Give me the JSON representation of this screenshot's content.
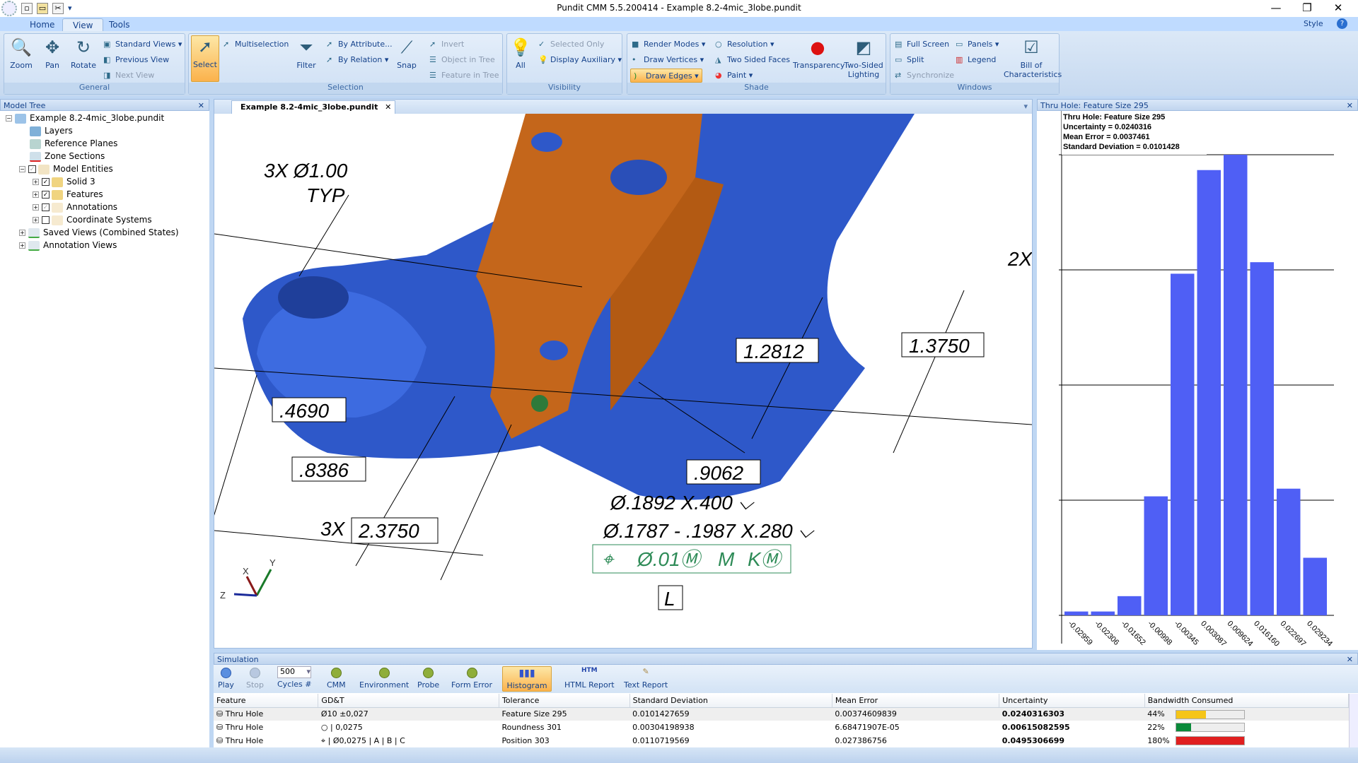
{
  "window": {
    "title": "Pundit CMM 5.5.200414 - Example 8.2-4mic_3lobe.pundit",
    "minimize": "—",
    "restore": "❐",
    "close": "✕"
  },
  "ribbon_tabs": [
    "Home",
    "View",
    "Tools"
  ],
  "active_tab": "View",
  "style_menu": "Style",
  "groups": {
    "general": {
      "label": "General",
      "zoom": "Zoom",
      "pan": "Pan",
      "rotate": "Rotate",
      "standard_views": "Standard Views",
      "previous_view": "Previous View",
      "next_view": "Next View"
    },
    "selection": {
      "label": "Selection",
      "select": "Select",
      "multiselection": "Multiselection",
      "filter": "Filter",
      "by_attribute": "By Attribute...",
      "by_relation": "By Relation",
      "snap": "Snap",
      "invert": "Invert",
      "object_in_tree": "Object in Tree",
      "feature_in_tree": "Feature in Tree"
    },
    "visibility": {
      "label": "Visibility",
      "all": "All",
      "selected_only": "Selected Only",
      "display_auxiliary": "Display Auxiliary"
    },
    "shade": {
      "label": "Shade",
      "render_modes": "Render Modes",
      "draw_vertices": "Draw Vertices",
      "draw_edges": "Draw Edges",
      "resolution": "Resolution",
      "two_sided_faces": "Two Sided Faces",
      "paint": "Paint",
      "transparency": "Transparency",
      "two_sided_lighting": "Two-Sided Lighting"
    },
    "windows": {
      "label": "Windows",
      "full_screen": "Full Screen",
      "split": "Split",
      "synchronize": "Synchronize",
      "panels": "Panels",
      "legend": "Legend",
      "bill_of_characteristics": "Bill of Characteristics"
    }
  },
  "model_tree": {
    "title": "Model Tree",
    "items": [
      {
        "label": "Example 8.2-4mic_3lobe.pundit"
      },
      {
        "label": "Layers"
      },
      {
        "label": "Reference Planes"
      },
      {
        "label": "Zone Sections"
      },
      {
        "label": "Model Entities"
      },
      {
        "label": "Solid 3",
        "checked": true
      },
      {
        "label": "Features",
        "checked": true
      },
      {
        "label": "Annotations",
        "checked": true
      },
      {
        "label": "Coordinate Systems",
        "checked": false
      },
      {
        "label": "Saved Views (Combined States)"
      },
      {
        "label": "Annotation Views"
      }
    ]
  },
  "viewport": {
    "tab": "Example 8.2-4mic_3lobe.pundit",
    "annotations": {
      "holes": "3X Ø1.00",
      "typ": "TYP",
      "d1": ".4690",
      "d2": ".8386",
      "d3": "2.3750",
      "d3_prefix": "3X",
      "d4": ".9062",
      "d5": "1.2812",
      "d6": "1.3750",
      "d7": "2X",
      "hole1": "Ø.1892 X.400 ⌵",
      "hole2": "Ø.1787 - .1987 X.280 ⌵",
      "fcf_symbol": "⌖",
      "fcf_tol": "Ø.01Ⓜ",
      "fcf_m": "M",
      "fcf_k": "KⓂ",
      "datum": "L"
    },
    "axes": {
      "x": "X",
      "y": "Y",
      "z": "Z"
    }
  },
  "histogram_panel": {
    "title": "Thru Hole: Feature Size 295",
    "chart_data": {
      "type": "bar",
      "title": "Thru Hole: Feature Size 295",
      "info": [
        "Uncertainty = 0.0240316",
        "Mean Error = 0.0037461",
        "Standard Deviation = 0.0101428"
      ],
      "categories": [
        "-0.02959",
        "-0.02306",
        "-0.01652",
        "-0.00998",
        "-0.00345",
        "0.003087",
        "0.009624",
        "0.016160",
        "0.022697",
        "0.029234"
      ],
      "values": [
        1,
        1,
        5,
        31,
        89,
        116,
        120,
        92,
        33,
        15
      ],
      "ylim": [
        0,
        120
      ],
      "grid": true,
      "color": "#4f5ff5"
    }
  },
  "simulation": {
    "title": "Simulation",
    "play": "Play",
    "stop": "Stop",
    "cycles": "500",
    "cycles_label": "Cycles #",
    "cmm": "CMM",
    "environment": "Environment",
    "probe": "Probe",
    "form_error": "Form Error",
    "histogram": "Histogram",
    "html_report": "HTML Report",
    "text_report": "Text Report",
    "columns": [
      "Feature",
      "GD&T",
      "Tolerance",
      "Standard Deviation",
      "Mean Error",
      "Uncertainty",
      "Bandwidth Consumed"
    ],
    "rows": [
      {
        "feature": "Thru Hole",
        "gdt": "Ø10  ±0,027",
        "tolerance": "Feature Size 295",
        "std": "0.0101427659",
        "mean": "0.00374609839",
        "unc": "0.0240316303",
        "bw": "44%",
        "bw_value": 44,
        "color": "#f5c518"
      },
      {
        "feature": "Thru Hole",
        "gdt": "○ | 0,0275",
        "tolerance": "Roundness 301",
        "std": "0.00304198938",
        "mean": "6.68471907E-05",
        "unc": "0.00615082595",
        "bw": "22%",
        "bw_value": 22,
        "color": "#0a8a3a"
      },
      {
        "feature": "Thru Hole",
        "gdt": "⌖ | Ø0,0275 | A | B | C",
        "tolerance": "Position 303",
        "std": "0.0110719569",
        "mean": "0.027386756",
        "unc": "0.0495306699",
        "bw": "180%",
        "bw_value": 180,
        "color": "#e02020"
      }
    ]
  }
}
